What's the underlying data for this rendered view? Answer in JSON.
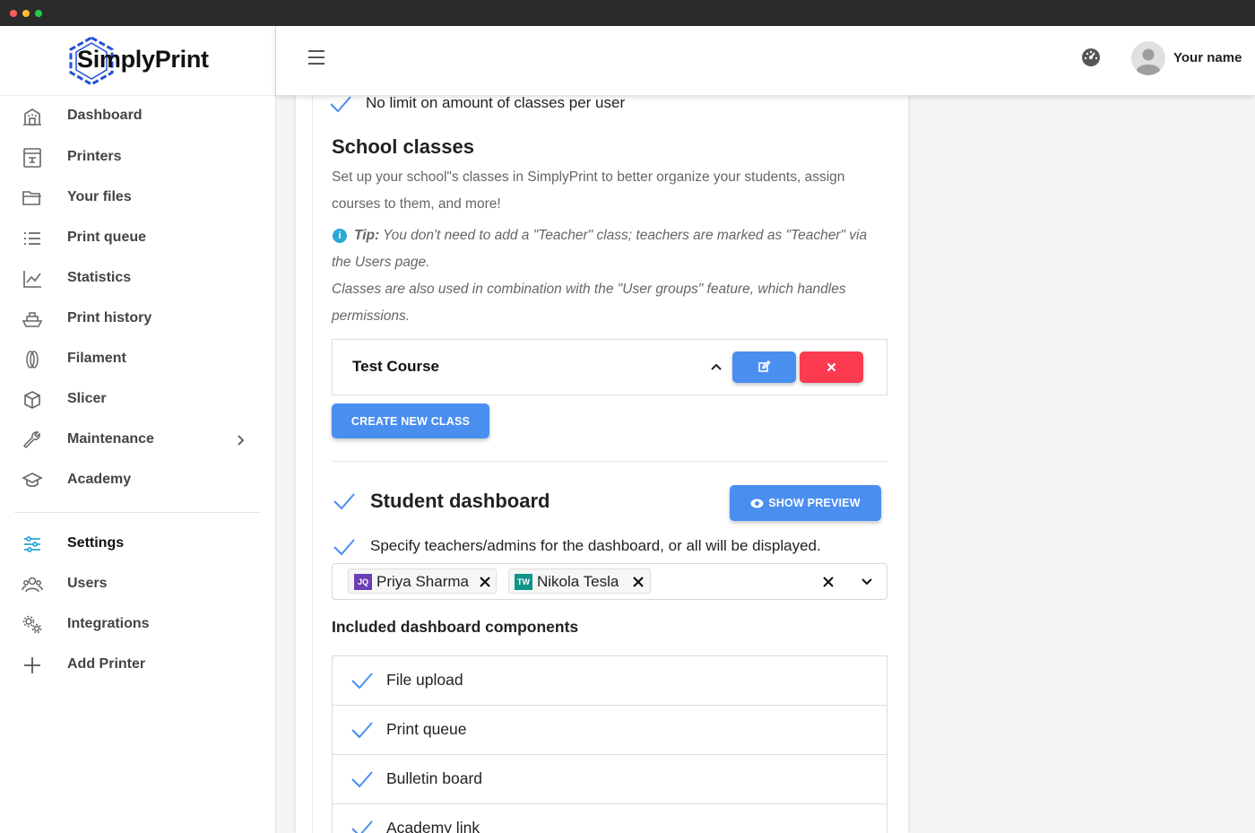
{
  "app": {
    "brand": "SimplyPrint"
  },
  "sidebar": {
    "items": [
      {
        "label": "Dashboard",
        "icon": "building-icon"
      },
      {
        "label": "Printers",
        "icon": "printer-icon"
      },
      {
        "label": "Your files",
        "icon": "folder-icon"
      },
      {
        "label": "Print queue",
        "icon": "list-icon"
      },
      {
        "label": "Statistics",
        "icon": "chart-line-icon"
      },
      {
        "label": "Print history",
        "icon": "ship-icon"
      },
      {
        "label": "Filament",
        "icon": "filament-icon"
      },
      {
        "label": "Slicer",
        "icon": "cube-icon"
      },
      {
        "label": "Maintenance",
        "icon": "wrench-icon"
      },
      {
        "label": "Academy",
        "icon": "graduation-cap-icon"
      },
      {
        "label": "Settings",
        "icon": "sliders-icon",
        "active": true
      },
      {
        "label": "Users",
        "icon": "users-icon"
      },
      {
        "label": "Integrations",
        "icon": "gears-icon"
      },
      {
        "label": "Add Printer",
        "icon": "plus-icon"
      }
    ]
  },
  "topbar": {
    "user_name": "Your name"
  },
  "main": {
    "limit_text": "No limit on amount of classes per user",
    "school_classes": {
      "title": "School classes",
      "desc_line1": "Set up your school\"s classes in SimplyPrint to better organize your students, assign",
      "desc_line2": "courses to them, and more!",
      "tip_label": "Tip:",
      "tip_line1": " You don't need to add a \"Teacher\" class; teachers are marked as \"Teacher\" via",
      "tip_line2": "the Users page.",
      "note_line1": "Classes are also used in combination with the \"User groups\" feature, which handles",
      "note_line2": "permissions.",
      "course_name": "Test Course",
      "create_button": "CREATE NEW CLASS"
    },
    "student_dashboard": {
      "title": "Student dashboard",
      "preview_button": "SHOW PREVIEW",
      "specify_text": "Specify teachers/admins for the dashboard, or all will be displayed.",
      "selected": [
        {
          "initials": "JQ",
          "name": "Priya Sharma",
          "color": "#6c3fb5"
        },
        {
          "initials": "TW",
          "name": "Nikola Tesla",
          "color": "#0f9488"
        }
      ],
      "components_title": "Included dashboard components",
      "components": [
        "File upload",
        "Print queue",
        "Bulletin board",
        "Academy link"
      ]
    }
  },
  "colors": {
    "accent": "#4a8ef0",
    "danger": "#fc3a50",
    "check": "#4a8ef0",
    "active_icon": "#2ba8d8"
  }
}
